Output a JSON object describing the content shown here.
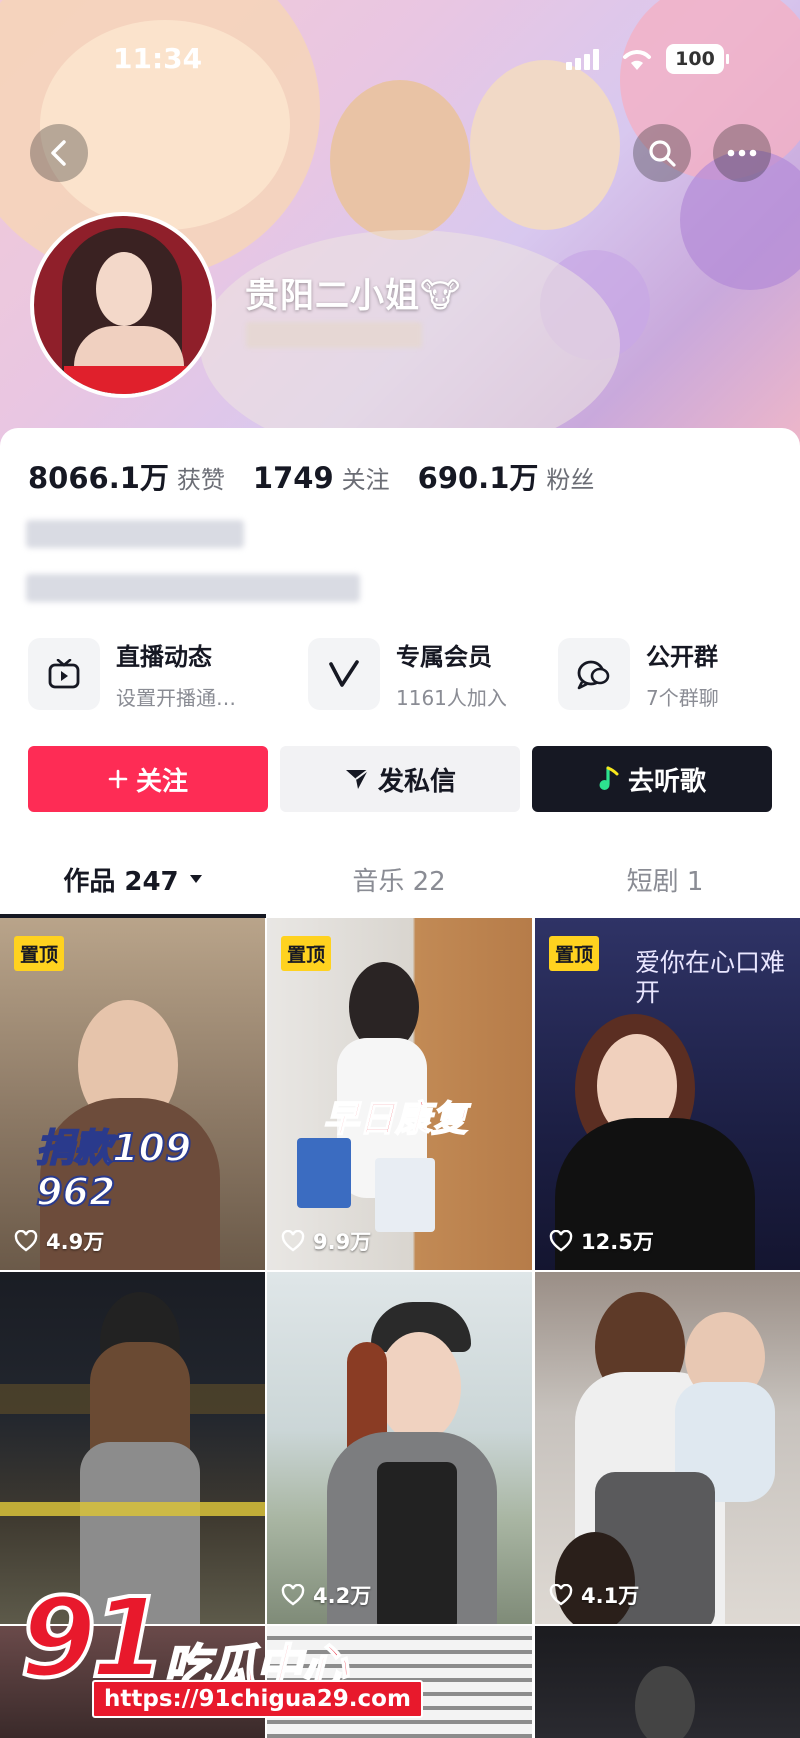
{
  "status_bar": {
    "time": "11:34",
    "battery": "100"
  },
  "profile": {
    "name": "贵阳二小姐🐮"
  },
  "stats": [
    {
      "value": "8066.1万",
      "label": "获赞"
    },
    {
      "value": "1749",
      "label": "关注"
    },
    {
      "value": "690.1万",
      "label": "粉丝"
    }
  ],
  "features": [
    {
      "title": "直播动态",
      "subtitle": "设置开播通…",
      "icon": "tv-icon"
    },
    {
      "title": "专属会员",
      "subtitle": "1161人加入",
      "icon": "v-member-icon"
    },
    {
      "title": "公开群",
      "subtitle": "7个群聊",
      "icon": "chat-group-icon"
    }
  ],
  "actions": {
    "follow": "关注",
    "message": "发私信",
    "listen": "去听歌"
  },
  "tabs": [
    {
      "label": "作品 247"
    },
    {
      "label": "音乐 22"
    },
    {
      "label": "短剧 1"
    }
  ],
  "videos": [
    {
      "pinned": "置顶",
      "likes": "4.9万",
      "caption": "捐款109 962"
    },
    {
      "pinned": "置顶",
      "likes": "9.9万",
      "caption": "早日康复"
    },
    {
      "pinned": "置顶",
      "likes": "12.5万",
      "caption": "爱你在心口难开"
    },
    {
      "likes": ""
    },
    {
      "likes": "4.2万"
    },
    {
      "likes": "4.1万"
    }
  ],
  "watermark": {
    "number": "91",
    "brand": "吃瓜中心",
    "url": "https://91chigua29.com"
  },
  "colors": {
    "follow": "#fe2c55",
    "pin": "#ffd21f",
    "dark": "#161823"
  }
}
